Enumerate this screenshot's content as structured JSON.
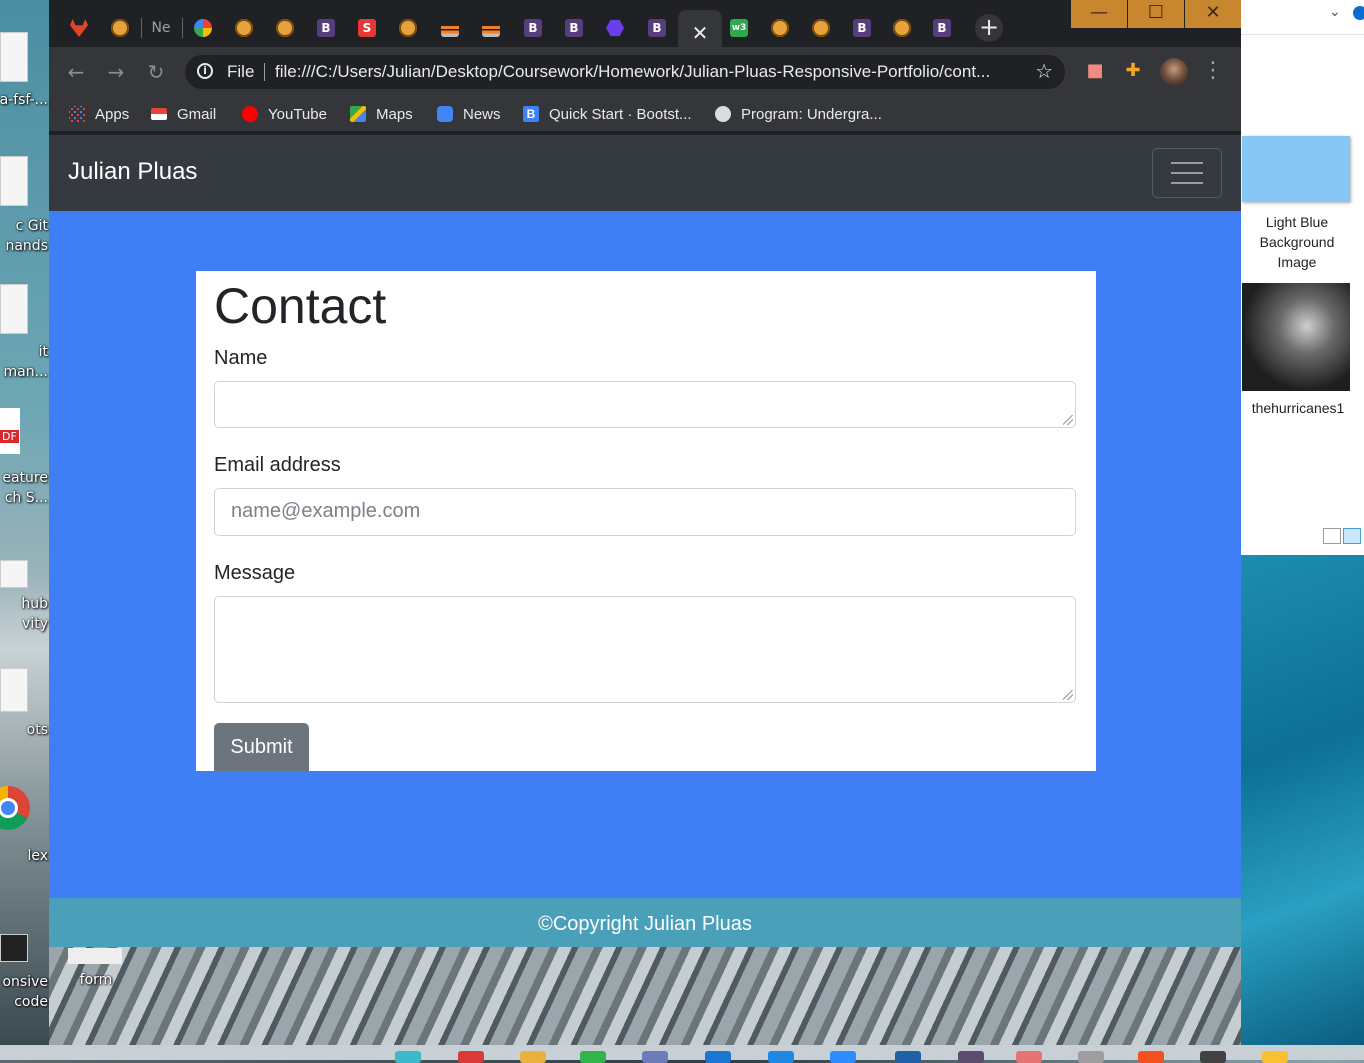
{
  "desktop": {
    "left_labels": [
      "a-fsf-...",
      "c Git",
      "nands",
      "it",
      "man...",
      "eature",
      "ch S...",
      "hub",
      "vity",
      "ots",
      "lex",
      "onsive",
      "code"
    ],
    "pdf_badge": "DF",
    "form_label": "form"
  },
  "explorer": {
    "item1": "Light Blue Background Image",
    "item2": "thehurricanes1"
  },
  "browser": {
    "tab_new_partial": "Ne",
    "omnibox": {
      "scheme": "File",
      "url": "file:///C:/Users/Julian/Desktop/Coursework/Homework/Julian-Pluas-Responsive-Portfolio/cont..."
    },
    "bookmarks": [
      "Apps",
      "Gmail",
      "YouTube",
      "Maps",
      "News",
      "Quick Start · Bootst...",
      "Program: Undergra..."
    ],
    "window_controls": {
      "minimize": "—",
      "maximize": "☐",
      "close": "✕"
    }
  },
  "page": {
    "brand": "Julian Pluas",
    "heading": "Contact",
    "name_label": "Name",
    "email_label": "Email address",
    "email_placeholder": "name@example.com",
    "message_label": "Message",
    "submit_label": "Submit",
    "footer": "©Copyright Julian Pluas"
  },
  "colors": {
    "page_bg": "#3f7ef5",
    "navbar": "#343a40",
    "footer": "#4a9fb9",
    "button": "#6c757d"
  }
}
